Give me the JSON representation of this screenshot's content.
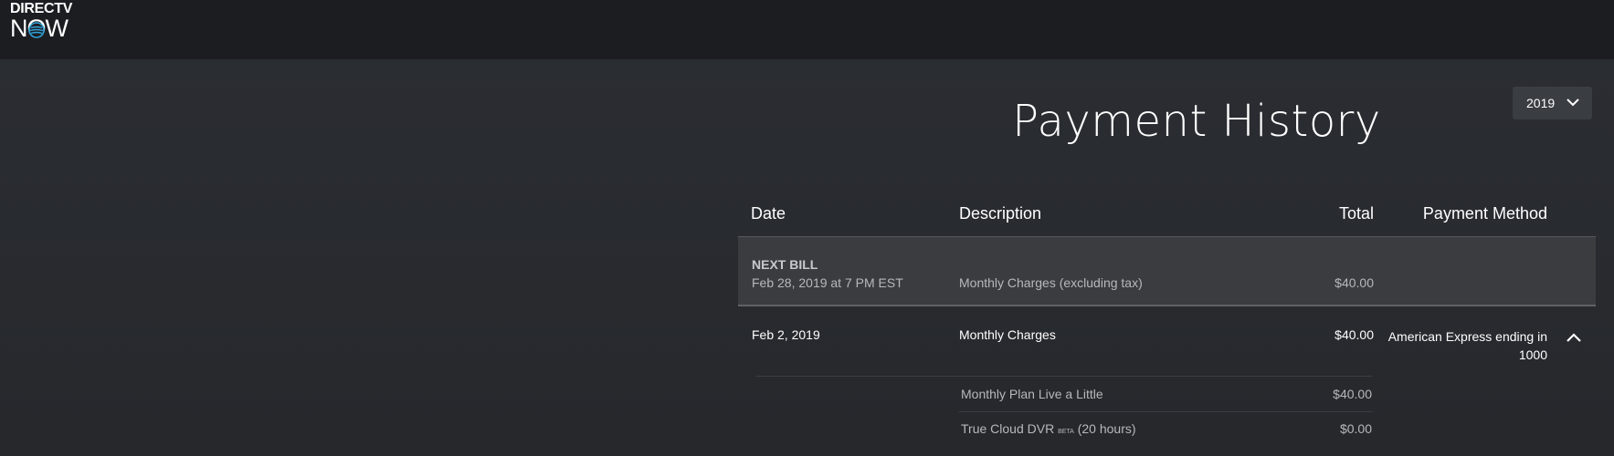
{
  "brand": {
    "logo_top": "DIRECTV",
    "logo_bottom": "NOW",
    "logo_icon": "att-globe-icon"
  },
  "header": {
    "title": "Payment History",
    "year_select": {
      "value": "2019",
      "icon": "chevron-down-icon"
    }
  },
  "table": {
    "columns": [
      "Date",
      "Description",
      "Total",
      "Payment Method"
    ],
    "next_bill": {
      "label": "NEXT BILL",
      "date": "Feb 28, 2019 at 7 PM EST",
      "description": "Monthly Charges (excluding tax)",
      "total": "$40.00"
    },
    "rows": [
      {
        "date": "Feb 2, 2019",
        "description": "Monthly Charges",
        "total": "$40.00",
        "payment_method": "American Express ending in 1000",
        "expand_icon": "chevron-up-icon",
        "items": [
          {
            "description": "Monthly Plan Live a Little",
            "total": "$40.00"
          },
          {
            "description": "True Cloud DVR",
            "badge": "BETA",
            "suffix": "(20 hours)",
            "total": "$0.00"
          }
        ]
      }
    ]
  },
  "colors": {
    "topbar": "#1c1d21",
    "background": "#26282c",
    "next_bill_bg": "#3a3c40",
    "text_primary": "#ffffff",
    "text_secondary": "#b7b8bb",
    "logo_globe": "#2fa3d9"
  }
}
